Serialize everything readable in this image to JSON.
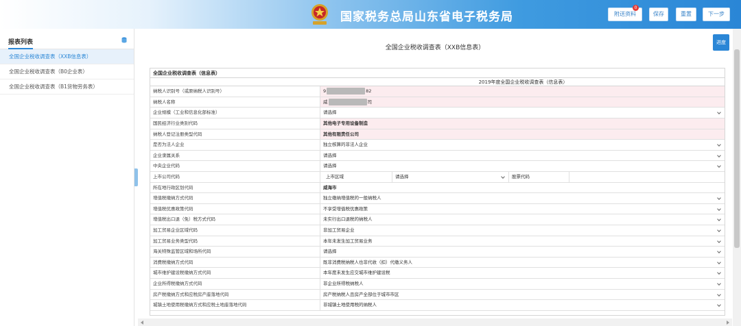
{
  "header": {
    "title": "国家税务总局山东省电子税务局",
    "buttons": [
      {
        "label": "附送资料",
        "badge": "0"
      },
      {
        "label": "保存"
      },
      {
        "label": "重置"
      },
      {
        "label": "下一步"
      }
    ]
  },
  "sidebar": {
    "title": "报表列表",
    "items": [
      {
        "label": "全国企业税收调查表（XXB信息表）",
        "active": true
      },
      {
        "label": "全国企业税收调查表（B0企业表）"
      },
      {
        "label": "全国企业税收调查表（B1货物劳务表）"
      }
    ]
  },
  "main": {
    "doc_title": "全国企业税收调查表（XXB信息表）",
    "progress_label": "进度",
    "table": {
      "caption": "全国企业税收调查表（信息表）",
      "subtitle": "2019年度全国企业税收调查表（信息表）",
      "rows": [
        {
          "label": "纳税人识别号（或原纳税人识别号）",
          "pre": "9",
          "post": "82",
          "masked": true
        },
        {
          "label": "纳税人名称",
          "pre": "威",
          "post": "司",
          "masked": true
        },
        {
          "label": "企业规模（工业和信息化部标准）",
          "value": "请选择",
          "select": true
        },
        {
          "label": "国民经济行业类别代码",
          "value": "其他电子专用设备制造",
          "bold": true
        },
        {
          "label": "纳税人登记注册类型代码",
          "value": "其他有限责任公司",
          "bold": true
        },
        {
          "label": "是否为法人企业",
          "value": "独立核算的非法人企业",
          "select": true
        },
        {
          "label": "企业隶属关系",
          "value": "请选择",
          "select": true
        },
        {
          "label": "中央企业代码",
          "value": "请选择",
          "select": true
        },
        {
          "label": "上市公司代码",
          "value": "上市区域",
          "sub_select": "请选择",
          "sub_label": "股票代码"
        },
        {
          "label": "所在地行政区划代码",
          "value": "威海市",
          "bold": true
        },
        {
          "label": "增值税缴纳方式代码",
          "value": "独立缴纳增值税的一般纳税人",
          "select": true
        },
        {
          "label": "增值税优惠政策代码",
          "value": "不享受增值税优惠政策",
          "select": true
        },
        {
          "label": "增值税出口退（免）税方式代码",
          "value": "未实行出口退税的纳税人",
          "select": true
        },
        {
          "label": "加工贸易企业区域代码",
          "value": "非加工贸易企业",
          "select": true
        },
        {
          "label": "加工贸易业务类型代码",
          "value": "本年未发生加工贸易业务",
          "select": true
        },
        {
          "label": "海关特殊监管区域和场所代码",
          "value": "请选择",
          "select": true
        },
        {
          "label": "消费税缴纳方式代码",
          "value": "既非消费税纳税人也非代收（扣）代缴义务人",
          "select": true
        },
        {
          "label": "城市维护建设税缴纳方式代码",
          "value": "本年度未发生应交城市维护建设税",
          "select": true
        },
        {
          "label": "企业所得税缴纳方式代码",
          "value": "非企业所得税纳税人",
          "select": true
        },
        {
          "label": "房产税缴纳方式和应税房产座落地代码",
          "value": "房产税纳税人且房产全部位于城市市区",
          "select": true
        },
        {
          "label": "城镇土地使用税缴纳方式和应税土地座落地代码",
          "value": "非城镇土地使用税的纳税人",
          "select": true
        }
      ]
    }
  },
  "colors": {
    "accent": "#2a86d6",
    "pink_row": "#fcecef"
  }
}
